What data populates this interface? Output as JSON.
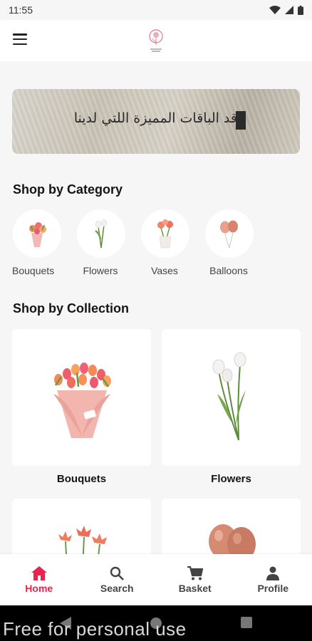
{
  "status_bar": {
    "time": "11:55",
    "icons": [
      "wifi-icon",
      "signal-icon",
      "battery-icon"
    ]
  },
  "app_bar": {
    "menu_icon": "hamburger-menu-icon",
    "logo_icon": "flower-logo-icon",
    "logo_text": ""
  },
  "banner": {
    "text": "قد الباقات المميزة اللتي لدينا"
  },
  "sections": {
    "category_title": "Shop by Category",
    "collection_title": "Shop by Collection"
  },
  "categories": [
    {
      "label": "Bouquets",
      "icon": "bouquet-icon"
    },
    {
      "label": "Flowers",
      "icon": "flower-stems-icon"
    },
    {
      "label": "Vases",
      "icon": "vase-icon"
    },
    {
      "label": "Balloons",
      "icon": "balloons-icon"
    }
  ],
  "collections": [
    {
      "label": "Bouquets",
      "icon": "tulip-bouquet-icon"
    },
    {
      "label": "Flowers",
      "icon": "white-tulips-icon"
    },
    {
      "label": "",
      "icon": "red-flowers-icon"
    },
    {
      "label": "",
      "icon": "rose-gold-balloons-icon"
    }
  ],
  "bottom_nav": [
    {
      "label": "Home",
      "icon": "home-icon",
      "active": true
    },
    {
      "label": "Search",
      "icon": "search-icon",
      "active": false
    },
    {
      "label": "Basket",
      "icon": "cart-icon",
      "active": false
    },
    {
      "label": "Profile",
      "icon": "person-icon",
      "active": false
    }
  ],
  "colors": {
    "accent": "#e8244d",
    "background": "#f6f6f6",
    "card": "#ffffff"
  },
  "watermark": "Free for personal use"
}
